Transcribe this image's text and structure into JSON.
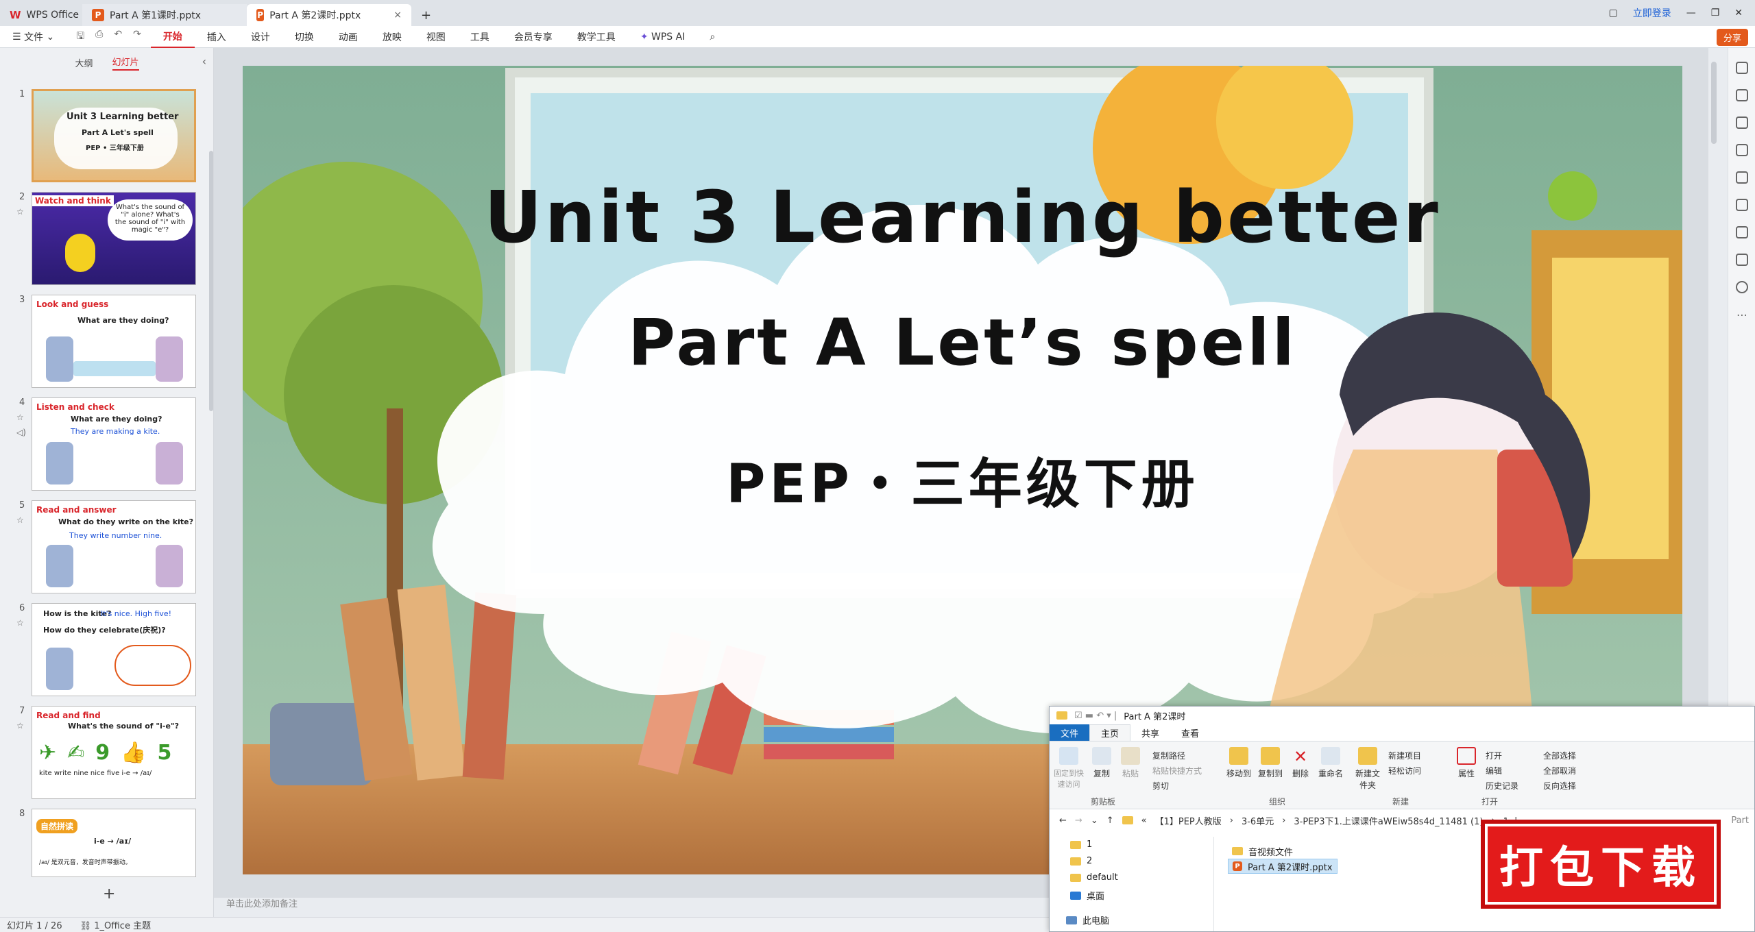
{
  "titlebar": {
    "home_tab": "WPS Office",
    "tabs": [
      "Part A 第1课时.pptx",
      "Part A 第2课时.pptx"
    ],
    "login": "立即登录"
  },
  "menubar": {
    "file": "文件",
    "items": [
      "开始",
      "插入",
      "设计",
      "切换",
      "动画",
      "放映",
      "视图",
      "工具",
      "会员专享",
      "教学工具"
    ],
    "wps_ai": "WPS AI",
    "share": "分享"
  },
  "panel": {
    "tab_outline": "大纲",
    "tab_slides": "幻灯片"
  },
  "slides": [
    {
      "num": "1",
      "title": "Unit 3 Learning better",
      "q": "Part A Let's spell",
      "a": "PEP • 三年级下册"
    },
    {
      "num": "2",
      "title": "Watch and think",
      "q": "What's the sound of \"i\" alone? What's the sound of \"i\" with magic \"e\"?",
      "a": ""
    },
    {
      "num": "3",
      "title": "Look and guess",
      "q": "What are they doing?",
      "a": ""
    },
    {
      "num": "4",
      "title": "Listen and check",
      "q": "What are they doing?",
      "a": "They are making a kite."
    },
    {
      "num": "5",
      "title": "Read and answer",
      "q": "What do they write on the kite?",
      "a": "They write number nine."
    },
    {
      "num": "6",
      "title": "How is the kite?",
      "q": "How do they celebrate(庆祝)?",
      "a": "It's nice. High five!"
    },
    {
      "num": "7",
      "title": "Read and find",
      "q": "What's the sound of \"i-e\"?",
      "a": "kite write nine nice five  i-e → /aɪ/"
    },
    {
      "num": "8",
      "title": "自然拼读",
      "q": "i-e → /aɪ/",
      "a": "/aɪ/ 是双元音，发音时声带振动。"
    }
  ],
  "main_slide": {
    "line1": "Unit 3 Learning better",
    "line2": "Part A Let’s spell",
    "line3": "PEP・三年级下册"
  },
  "note_placeholder": "单击此处添加备注",
  "status": {
    "slide_count": "幻灯片 1 / 26",
    "theme": "1_Office 主题"
  },
  "explorer": {
    "title": "Part A 第2课时",
    "tabs": [
      "文件",
      "主页",
      "共享",
      "查看"
    ],
    "ribbon": {
      "pin": "固定到快速访问",
      "copy": "复制",
      "paste": "粘贴",
      "copy_path": "复制路径",
      "paste_shortcut": "粘贴快捷方式",
      "cut": "剪切",
      "move_to": "移动到",
      "copy_to": "复制到",
      "delete": "删除",
      "rename": "重命名",
      "new_folder": "新建文件夹",
      "new_item": "新建项目",
      "easy_access": "轻松访问",
      "properties": "属性",
      "open": "打开",
      "edit": "编辑",
      "history": "历史记录",
      "select_all": "全部选择",
      "select_none": "全部取消",
      "invert": "反向选择",
      "g_clipboard": "剪贴板",
      "g_organize": "组织",
      "g_new": "新建",
      "g_open": "打开"
    },
    "path": [
      "【1】PEP人教版",
      "3-6单元",
      "3-PEP3下1.上课课件aWEiw58s4d_11481 (1)",
      "1.上"
    ],
    "path_tail": "Part",
    "nav": [
      "1",
      "2",
      "default",
      "桌面",
      "此电脑"
    ],
    "files": [
      "音视频文件",
      "Part A 第2课时.pptx"
    ]
  },
  "badge": "打包下载"
}
